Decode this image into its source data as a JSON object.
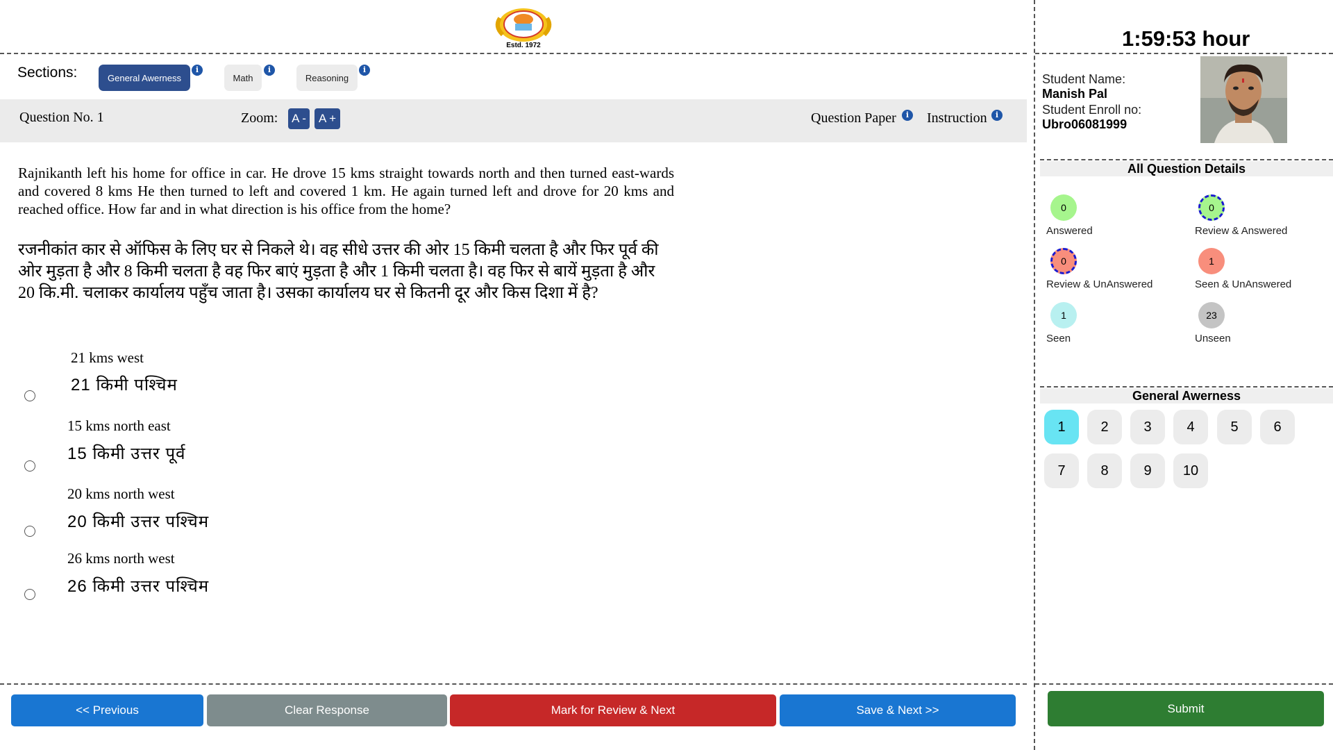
{
  "header": {
    "logo_text": "Estd. 1972"
  },
  "sections": {
    "label": "Sections:",
    "tabs": [
      {
        "label": "General Awerness",
        "active": true
      },
      {
        "label": "Math",
        "active": false
      },
      {
        "label": "Reasoning",
        "active": false
      }
    ],
    "info_glyph": "i"
  },
  "question_bar": {
    "question_no": "Question No. 1",
    "zoom_label": "Zoom:",
    "zoom_out": "A -",
    "zoom_in": "A +",
    "question_paper": "Question Paper",
    "instruction": "Instruction"
  },
  "question": {
    "text_en": "Rajnikanth left his home for office in car. He drove 15 kms straight towards north and then turned east-wards and covered 8 kms He then turned to left and covered 1 km. He again turned left and drove for 20 kms and reached office. How far and in what direction is his office from the home?",
    "text_hi": "रजनीकांत कार से ऑफिस के लिए घर से निकले थे। वह सीधे उत्तर की ओर 15 किमी चलता है और फिर पूर्व की ओर मुड़ता है और 8 किमी चलता है वह फिर बाएं मुड़ता है और 1 किमी चलता है। वह फिर से बायें मुड़ता है और 20 कि.मी. चलाकर कार्यालय पहुँच जाता है। उसका कार्यालय घर से कितनी दूर और किस दिशा में है?",
    "options": [
      {
        "en": "21 kms west",
        "hi": "21 किमी पश्चिम"
      },
      {
        "en": "15 kms north east",
        "hi": "15 किमी उत्तर पूर्व"
      },
      {
        "en": "20 kms north west",
        "hi": "20 किमी उत्तर पश्चिम"
      },
      {
        "en": "26 kms north west",
        "hi": "26 किमी उत्तर पश्चिम"
      }
    ]
  },
  "buttons": {
    "previous": "<< Previous",
    "clear": "Clear Response",
    "mark_review": "Mark for Review & Next",
    "save_next": "Save & Next >>",
    "submit": "Submit"
  },
  "timer": "1:59:53 hour",
  "student": {
    "name_label": "Student Name:",
    "name": "Manish Pal",
    "enroll_label": "Student Enroll no:",
    "enroll": "Ubro06081999"
  },
  "details": {
    "heading": "All Question Details",
    "legend": [
      {
        "count": "0",
        "label": "Answered",
        "color": "#a6f58d",
        "border": "none"
      },
      {
        "count": "0",
        "label": "Review & Answered",
        "color": "#a6f58d",
        "border": "#1a1acf"
      },
      {
        "count": "0",
        "label": "Review & UnAnswered",
        "color": "#f88e7c",
        "border": "#1a1acf"
      },
      {
        "count": "1",
        "label": "Seen & UnAnswered",
        "color": "#f88e7c",
        "border": "none"
      },
      {
        "count": "1",
        "label": "Seen",
        "color": "#b8f0f0",
        "border": "none"
      },
      {
        "count": "23",
        "label": "Unseen",
        "color": "#c4c4c4",
        "border": "none"
      }
    ]
  },
  "question_palette": {
    "heading": "General Awerness",
    "numbers": [
      "1",
      "2",
      "3",
      "4",
      "5",
      "6",
      "7",
      "8",
      "9",
      "10"
    ],
    "current": "1"
  },
  "colors": {
    "primary_blue": "#1976d2",
    "grey": "#7e8c8d",
    "red": "#c62828",
    "green": "#2e7d32",
    "tab_active": "#2d4e8e"
  }
}
